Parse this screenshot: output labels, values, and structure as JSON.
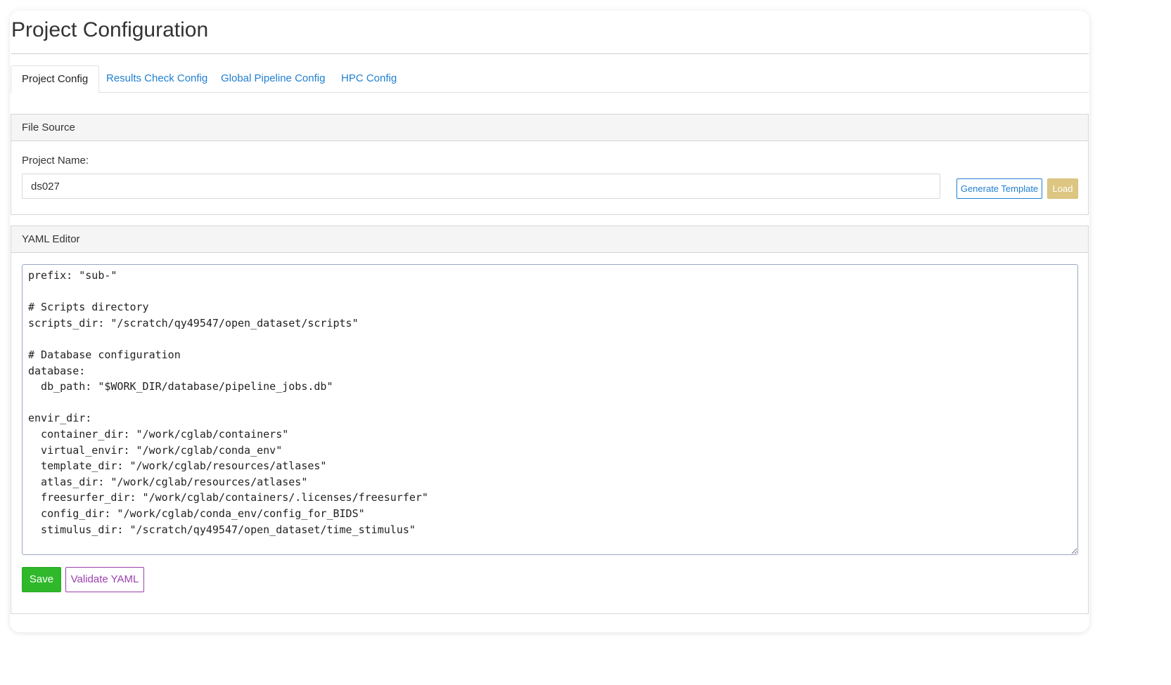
{
  "page": {
    "title": "Project Configuration"
  },
  "tabs": [
    {
      "label": "Project Config",
      "active": true
    },
    {
      "label": "Results Check Config",
      "active": false
    },
    {
      "label": "Global Pipeline Config",
      "active": false
    },
    {
      "label": "HPC Config",
      "active": false
    }
  ],
  "file_source": {
    "header": "File Source",
    "project_name_label": "Project Name:",
    "project_name_value": "ds027",
    "generate_template_label": "Generate Template",
    "load_label": "Load"
  },
  "yaml_editor": {
    "header": "YAML Editor",
    "content": "prefix: \"sub-\"\n\n# Scripts directory\nscripts_dir: \"/scratch/qy49547/open_dataset/scripts\"\n\n# Database configuration\ndatabase:\n  db_path: \"$WORK_DIR/database/pipeline_jobs.db\"\n\nenvir_dir:\n  container_dir: \"/work/cglab/containers\"\n  virtual_envir: \"/work/cglab/conda_env\"\n  template_dir: \"/work/cglab/resources/atlases\"\n  atlas_dir: \"/work/cglab/resources/atlases\"\n  freesurfer_dir: \"/work/cglab/containers/.licenses/freesurfer\"\n  config_dir: \"/work/cglab/conda_env/config_for_BIDS\"\n  stimulus_dir: \"/scratch/qy49547/open_dataset/time_stimulus\"",
    "save_label": "Save",
    "validate_label": "Validate YAML"
  },
  "colors": {
    "link": "#1f7fd1",
    "save": "#2fb82a",
    "validate": "#9b3fb0",
    "load": "#dcc681"
  }
}
